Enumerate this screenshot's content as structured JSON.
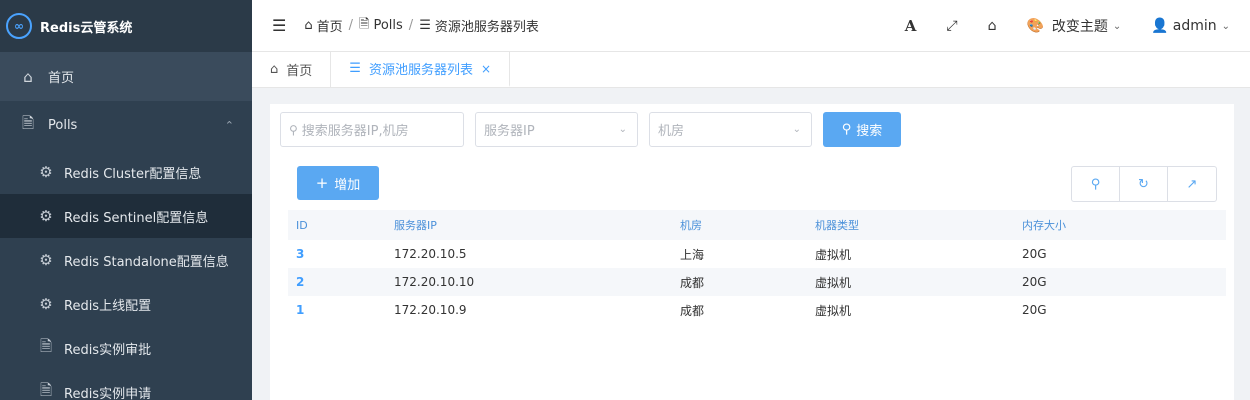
{
  "app": {
    "title": "Redis云管系统",
    "logo_glyph": "∞"
  },
  "sidebar": {
    "items": [
      {
        "label": "首页",
        "icon": "home-icon"
      },
      {
        "label": "Polls",
        "icon": "file-icon"
      }
    ],
    "submenu": [
      {
        "label": "Redis Cluster配置信息",
        "icon": "gear-icon"
      },
      {
        "label": "Redis Sentinel配置信息",
        "icon": "gear-icon"
      },
      {
        "label": "Redis Standalone配置信息",
        "icon": "gear-icon"
      },
      {
        "label": "Redis上线配置",
        "icon": "gear-icon"
      },
      {
        "label": "Redis实例审批",
        "icon": "file-icon"
      },
      {
        "label": "Redis实例申请",
        "icon": "file-icon"
      }
    ]
  },
  "header": {
    "breadcrumb": [
      "首页",
      "Polls",
      "资源池服务器列表"
    ],
    "font_label": "A",
    "theme_label": "改变主题",
    "user_label": "admin"
  },
  "tabs": [
    {
      "label": "首页",
      "icon": "home-icon"
    },
    {
      "label": "资源池服务器列表",
      "icon": "list-icon",
      "close": "×"
    }
  ],
  "filters": {
    "search_placeholder": "搜索服务器IP,机房",
    "ip_placeholder": "服务器IP",
    "room_placeholder": "机房",
    "search_button": "搜索"
  },
  "toolbar": {
    "add_label": "增加"
  },
  "table": {
    "headers": [
      "ID",
      "服务器IP",
      "机房",
      "机器类型",
      "内存大小"
    ],
    "rows": [
      [
        "3",
        "172.20.10.5",
        "上海",
        "虚拟机",
        "20G"
      ],
      [
        "2",
        "172.20.10.10",
        "成都",
        "虚拟机",
        "20G"
      ],
      [
        "1",
        "172.20.10.9",
        "成都",
        "虚拟机",
        "20G"
      ]
    ]
  },
  "colors": {
    "sidebar_bg": "#2f4050",
    "accent": "#409eff",
    "button": "#5aa8f2"
  }
}
